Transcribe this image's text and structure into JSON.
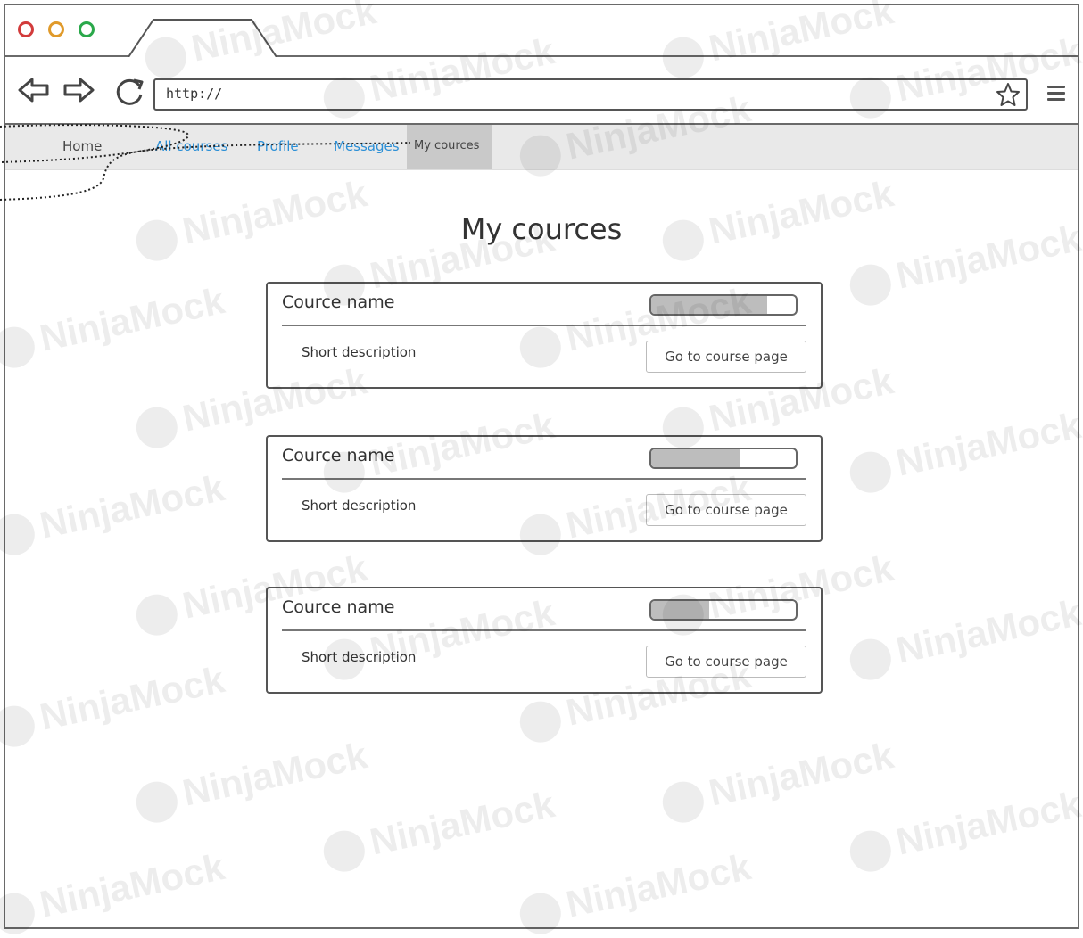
{
  "browser": {
    "url": "http://",
    "traffic_lights": [
      "#d23b3b",
      "#e09a2a",
      "#2aa84a"
    ]
  },
  "nav": {
    "home": "Home",
    "all_courses": "All courses",
    "profile": "Profile",
    "messages": "Messages",
    "my_courses": "My cources"
  },
  "page": {
    "title": "My cources"
  },
  "courses": [
    {
      "name": "Cource name",
      "description": "Short description",
      "button": "Go to course page",
      "progress": 0.8
    },
    {
      "name": "Cource name",
      "description": "Short description",
      "button": "Go to course page",
      "progress": 0.62
    },
    {
      "name": "Cource name",
      "description": "Short description",
      "button": "Go to course page",
      "progress": 0.4
    }
  ],
  "watermark": "NinjaMock"
}
